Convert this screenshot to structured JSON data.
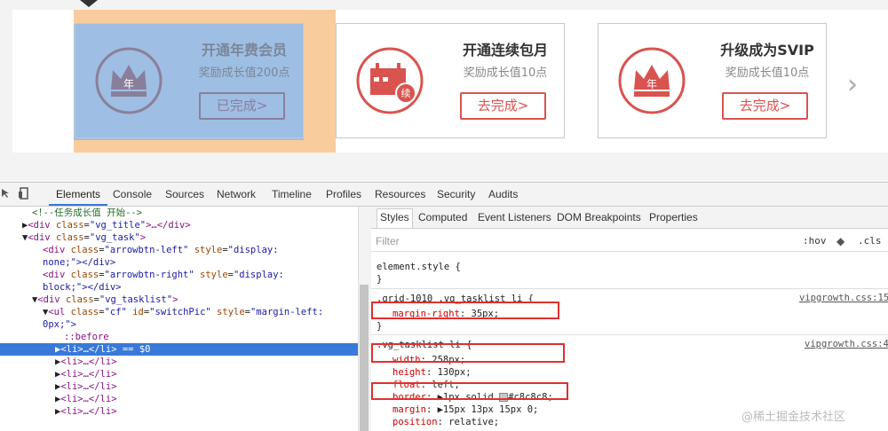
{
  "page": {
    "cards": [
      {
        "title": "开通年费会员",
        "subtitle": "奖励成长值200点",
        "button": "已完成>",
        "badge_text": "年"
      },
      {
        "title": "开通连续包月",
        "subtitle": "奖励成长值10点",
        "button": "去完成>",
        "badge_text": "续"
      },
      {
        "title": "升级成为SVIP",
        "subtitle": "奖励成长值10点",
        "button": "去完成>",
        "badge_text": "年"
      }
    ],
    "next_arrow": "›"
  },
  "devtools": {
    "tabs": [
      "Elements",
      "Console",
      "Sources",
      "Network",
      "Timeline",
      "Profiles",
      "Resources",
      "Security",
      "Audits"
    ],
    "active_tab": "Elements",
    "elements": {
      "l0": {
        "comment": "<!--任务成长值 开始-->"
      },
      "l1": {
        "tag_open": "<div ",
        "attr": "class",
        "val": "\"vg_title\"",
        "rest": ">…</div>"
      },
      "l2": {
        "tag_open": "<div ",
        "attr": "class",
        "val": "\"vg_task\"",
        "rest": ">"
      },
      "l3": {
        "tag_open": "<div ",
        "attr": "class",
        "val": "\"arrowbtn-left\"",
        "attr2": "style",
        "val2": "\"display:"
      },
      "l4": {
        "text": "none;\"></div>"
      },
      "l5": {
        "tag_open": "<div ",
        "attr": "class",
        "val": "\"arrowbtn-right\"",
        "attr2": "style",
        "val2": "\"display:"
      },
      "l6": {
        "text": "block;\"></div>"
      },
      "l7": {
        "tag_open": "<div ",
        "attr": "class",
        "val": "\"vg_tasklist\"",
        "rest": ">"
      },
      "l8": {
        "tag_open": "<ul ",
        "attr": "class",
        "val": "\"cf\"",
        "attr2": "id",
        "val2": "\"switchPic\"",
        "attr3": "style",
        "val3": "\"margin-left:"
      },
      "l9": {
        "text": "0px;\">"
      },
      "l10": {
        "text": "::before"
      },
      "l11": {
        "text": "<li>…</li> == $0"
      },
      "li_rows": [
        "<li>…</li>",
        "<li>…</li>",
        "<li>…</li>",
        "<li>…</li>",
        "<li>…</li>"
      ]
    },
    "styles": {
      "tabs": [
        "Styles",
        "Computed",
        "Event Listeners",
        "DOM Breakpoints",
        "Properties"
      ],
      "filter_placeholder": "Filter",
      "hov": ":hov",
      "cls": ".cls",
      "element_style": "element.style {",
      "close": "}",
      "rule1": {
        "selector": ".grid-1010 .vg_tasklist li {",
        "source": "vipgrowth.css:15",
        "prop": "margin-right",
        "value": "35px;"
      },
      "rule2": {
        "selector": ".vg_tasklist li {",
        "source": "vipgrowth.css:4",
        "decls": [
          {
            "prop": "width",
            "value": "258px;"
          },
          {
            "prop": "height",
            "value": "130px;"
          },
          {
            "prop": "float",
            "value": "left;"
          },
          {
            "prop": "border",
            "value": "1px solid",
            "color": "#c8c8c8;"
          },
          {
            "prop": "margin",
            "value": "15px 13px 15px 0;"
          },
          {
            "prop": "position",
            "value": "relative;"
          }
        ]
      }
    }
  },
  "watermark": "@稀土掘金技术社区",
  "colors": {
    "brand_red": "#d9534f",
    "devtools_blue": "#3879d9",
    "margin_highlight": "#f9cc9d",
    "content_highlight": "#9ebee3"
  }
}
